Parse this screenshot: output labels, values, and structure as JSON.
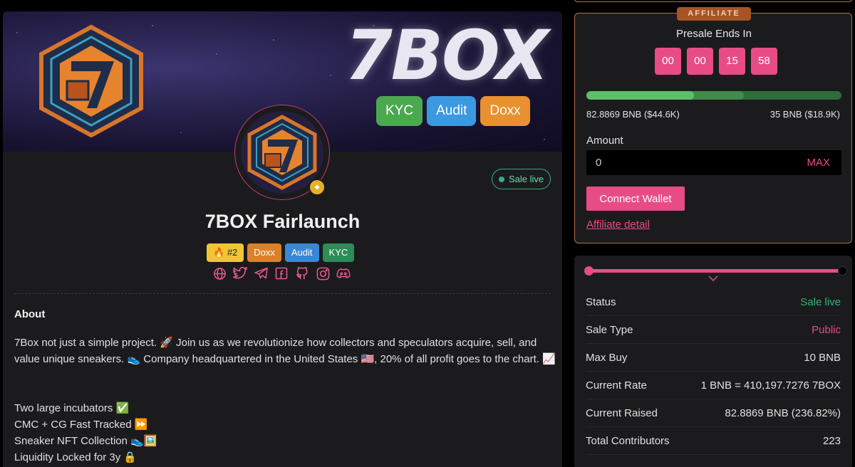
{
  "banner": {
    "title": "7BOX",
    "badges": [
      "KYC",
      "Audit",
      "Doxx"
    ]
  },
  "project": {
    "name": "7BOX Fairlaunch",
    "status": "Sale live",
    "rank": "#2",
    "tags": [
      "Doxx",
      "Audit",
      "KYC"
    ],
    "socials": [
      "globe-icon",
      "twitter-icon",
      "telegram-icon",
      "facebook-icon",
      "github-icon",
      "instagram-icon",
      "discord-icon"
    ]
  },
  "about": {
    "heading": "About",
    "paragraph": "7Box not just a simple project. 🚀 Join us as we revolutionize how collectors and speculators acquire, sell, and value unique sneakers. 👟 Company headquartered in the United States 🇺🇸, 20% of all profit goes to the chart. 📈",
    "features": [
      "Two large incubators ✅",
      "CMC + CG Fast Tracked ⏩",
      "Sneaker NFT Collection 👟🖼️",
      "Liquidity Locked for 3y 🔒"
    ]
  },
  "affiliate": {
    "label": "AFFILIATE",
    "ends_in": "Presale Ends In",
    "countdown": [
      "00",
      "00",
      "15",
      "58"
    ],
    "progress_fraction": 0.42,
    "raised_text": "82.8869 BNB ($44.6K)",
    "target_text": "35 BNB ($18.9K)",
    "amount_label": "Amount",
    "amount_value": "0",
    "max_label": "MAX",
    "connect_label": "Connect Wallet",
    "detail_label": "Affiliate detail"
  },
  "stats": [
    {
      "k": "Status",
      "v": "Sale live",
      "color": "green"
    },
    {
      "k": "Sale Type",
      "v": "Public",
      "color": "pink"
    },
    {
      "k": "Max Buy",
      "v": "10 BNB",
      "color": ""
    },
    {
      "k": "Current Rate",
      "v": "1 BNB = 410,197.7276 7BOX",
      "color": ""
    },
    {
      "k": "Current Raised",
      "v": "82.8869 BNB (236.82%)",
      "color": ""
    },
    {
      "k": "Total Contributors",
      "v": "223",
      "color": ""
    }
  ],
  "colors": {
    "accent": "#e84c87",
    "green": "#2fb67c",
    "affiliate_border": "#b0704a"
  }
}
